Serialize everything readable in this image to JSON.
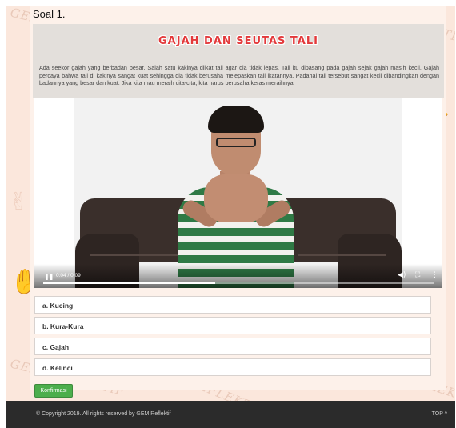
{
  "quiz": {
    "question_label": "Soal 1.",
    "story_title": "GAJAH DAN SEUTAS TALI",
    "story_text": "Ada seekor gajah yang berbadan besar. Salah satu kakinya diikat tali agar dia tidak lepas. Tali itu dipasang pada gajah sejak gajah masih kecil. Gajah percaya bahwa tali di kakinya sangat kuat sehingga dia tidak berusaha melepaskan tali ikatannya. Padahal tali tersebut sangat kecil dibandingkan dengan badannya yang besar dan kuat. Jika kita mau meraih cita-cita, kita harus berusaha keras meraihnya.",
    "options": [
      {
        "label": "a. Kucing"
      },
      {
        "label": "b. Kura-Kura"
      },
      {
        "label": "c. Gajah"
      },
      {
        "label": "d. Kelinci"
      }
    ],
    "confirm_label": "Konfirmasi"
  },
  "video": {
    "time_display": "0:04 / 0:09",
    "progress_fraction": 0.44,
    "play_icon": "pause-icon",
    "volume_icon": "volume-icon",
    "fullscreen_icon": "fullscreen-icon",
    "more_icon": "more-vertical-icon"
  },
  "background": {
    "watermark": "GEM REFLEKTIF"
  },
  "footer": {
    "copyright": "© Copyright 2019. All rights reserved by GEM Reflektif",
    "top_link": "TOP ^"
  },
  "colors": {
    "page_bg": "#fbe7dc",
    "title_red": "#e3393b",
    "confirm_green": "#4cae4c",
    "footer_bg": "#2b2b2b"
  }
}
